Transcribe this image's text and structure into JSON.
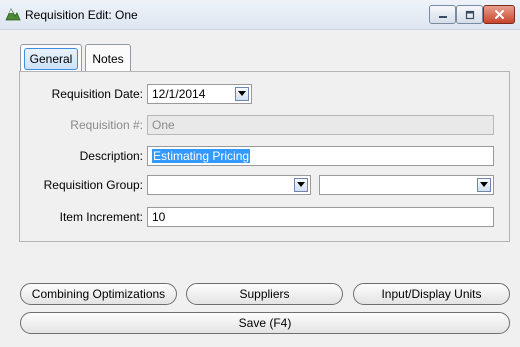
{
  "window": {
    "title": "Requisition Edit: One"
  },
  "tabs": [
    {
      "label": "General",
      "selected": true
    },
    {
      "label": "Notes",
      "selected": false
    }
  ],
  "form": {
    "requisition_date_label": "Requisition Date:",
    "requisition_date_value": "12/1/2014",
    "requisition_number_label": "Requisition #:",
    "requisition_number_value": "One",
    "description_label": "Description:",
    "description_value": "Estimating Pricing",
    "requisition_group_label": "Requisition Group:",
    "requisition_group_value_1": "",
    "requisition_group_value_2": "",
    "item_increment_label": "Item Increment:",
    "item_increment_value": "10"
  },
  "buttons": {
    "combining_optimizations": "Combining Optimizations",
    "suppliers": "Suppliers",
    "input_display_units": "Input/Display Units",
    "save": "Save (F4)"
  },
  "colors": {
    "selection": "#3399ff",
    "close_button": "#c7442b",
    "tab_highlight": "#3d8ee0"
  }
}
